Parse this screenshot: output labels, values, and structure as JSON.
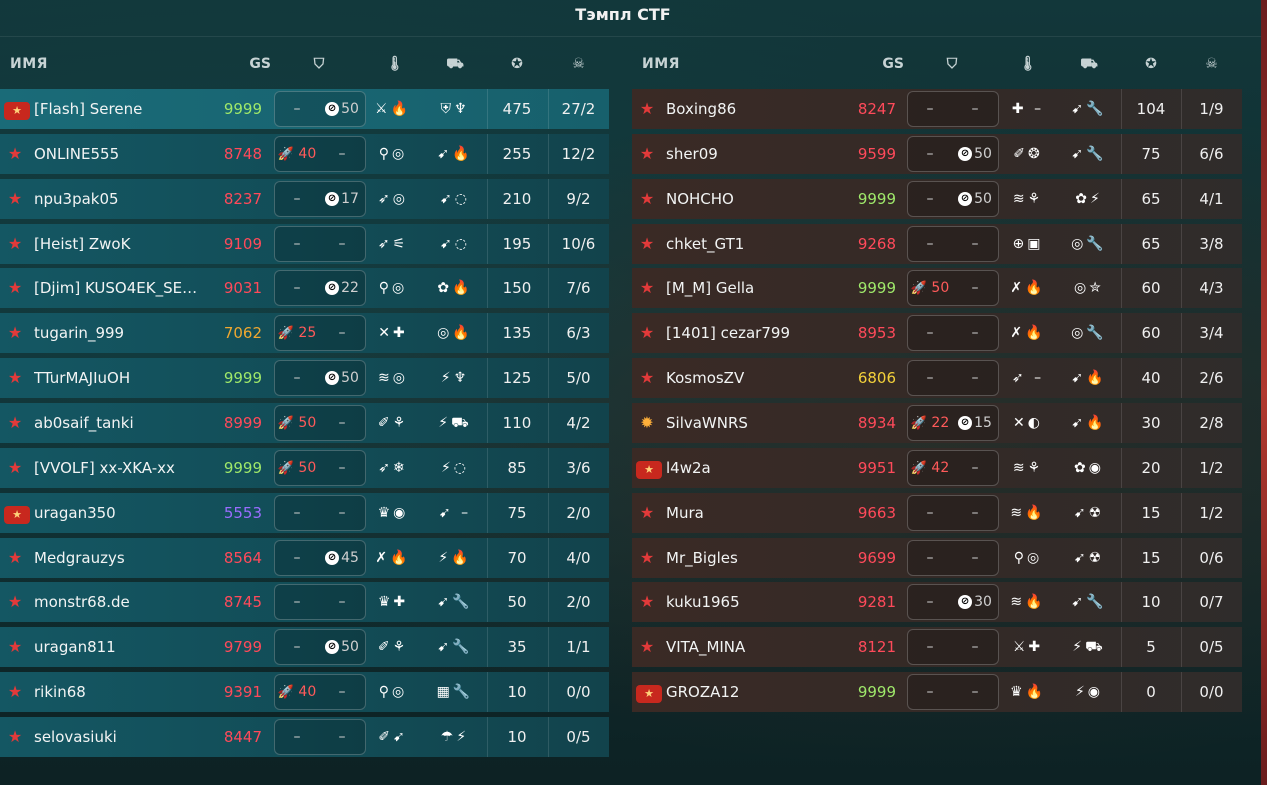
{
  "title": "Тэмпл CTF",
  "colors": {
    "gs_red": "#ff4a5a",
    "gs_green": "#9fe86a",
    "gs_orange": "#f0a830",
    "gs_purple": "#9a6cff",
    "gs_yellow": "#f3d13a"
  },
  "headers": {
    "name": "ИМЯ",
    "gs": "GS",
    "protect_icon": "shield-icon",
    "turret_icon": "thermometer-icon",
    "hull_icon": "tank-icon",
    "score_icon": "star-icon",
    "kd_icon": "skull-icon"
  },
  "team1": [
    {
      "name": "[Flash] Serene",
      "gs": "9999",
      "gs_color": "green",
      "sup_l": "–",
      "sup_r": "50",
      "sup_r_type": "cap",
      "eq1": "⚔🔥",
      "eq2": "⛨♆",
      "score": "475",
      "kd": "27/2",
      "rank": "legend"
    },
    {
      "name": "ONLINE555",
      "gs": "8748",
      "gs_color": "red",
      "sup_l": "40",
      "sup_l_type": "rocket",
      "sup_r": "–",
      "eq1": "⚲◎",
      "eq2": "➹🔥",
      "score": "255",
      "kd": "12/2",
      "rank": "star"
    },
    {
      "name": "npu3pak05",
      "gs": "8237",
      "gs_color": "red",
      "sup_l": "–",
      "sup_r": "17",
      "sup_r_type": "cap",
      "eq1": "➶◎",
      "eq2": "➹◌",
      "score": "210",
      "kd": "9/2",
      "rank": "star"
    },
    {
      "name": "[Heist] ZwoK",
      "gs": "9109",
      "gs_color": "red",
      "sup_l": "–",
      "sup_r": "–",
      "eq1": "➶⚟",
      "eq2": "➹◌",
      "score": "195",
      "kd": "10/6",
      "rank": "star"
    },
    {
      "name": "[Djim] KUSO4EK_SER...",
      "gs": "9031",
      "gs_color": "red",
      "sup_l": "–",
      "sup_r": "22",
      "sup_r_type": "cap",
      "eq1": "⚲◎",
      "eq2": "✿🔥",
      "score": "150",
      "kd": "7/6",
      "rank": "star"
    },
    {
      "name": "tugarin_999",
      "gs": "7062",
      "gs_color": "orange",
      "sup_l": "25",
      "sup_l_type": "rocket",
      "sup_r": "–",
      "eq1": "✕✚",
      "eq2": "◎🔥",
      "score": "135",
      "kd": "6/3",
      "rank": "star"
    },
    {
      "name": "TTurMAJIuOH",
      "gs": "9999",
      "gs_color": "green",
      "sup_l": "–",
      "sup_r": "50",
      "sup_r_type": "cap",
      "eq1": "≋◎",
      "eq2": "⚡♆",
      "score": "125",
      "kd": "5/0",
      "rank": "star"
    },
    {
      "name": "ab0saif_tanki",
      "gs": "8999",
      "gs_color": "red",
      "sup_l": "50",
      "sup_l_type": "rocket",
      "sup_r": "–",
      "eq1": "✐⚘",
      "eq2": "⚡⛟",
      "score": "110",
      "kd": "4/2",
      "rank": "star"
    },
    {
      "name": "[VVOLF] xx-XKA-xx",
      "gs": "9999",
      "gs_color": "green",
      "sup_l": "50",
      "sup_l_type": "rocket",
      "sup_r": "–",
      "eq1": "➶❄",
      "eq2": "⚡◌",
      "score": "85",
      "kd": "3/6",
      "rank": "star"
    },
    {
      "name": "uragan350",
      "gs": "5553",
      "gs_color": "purple",
      "sup_l": "–",
      "sup_r": "–",
      "eq1": "♛◉",
      "eq2": "➹ –",
      "score": "75",
      "kd": "2/0",
      "rank": "legend2"
    },
    {
      "name": "Medgrauzys",
      "gs": "8564",
      "gs_color": "red",
      "sup_l": "–",
      "sup_r": "45",
      "sup_r_type": "cap",
      "eq1": "✗🔥",
      "eq2": "⚡🔥",
      "score": "70",
      "kd": "4/0",
      "rank": "star"
    },
    {
      "name": "monstr68.de",
      "gs": "8745",
      "gs_color": "red",
      "sup_l": "–",
      "sup_r": "–",
      "eq1": "♛✚",
      "eq2": "➹🔧",
      "score": "50",
      "kd": "2/0",
      "rank": "star"
    },
    {
      "name": "uragan811",
      "gs": "9799",
      "gs_color": "red",
      "sup_l": "–",
      "sup_r": "50",
      "sup_r_type": "cap",
      "eq1": "✐⚘",
      "eq2": "➹🔧",
      "score": "35",
      "kd": "1/1",
      "rank": "star"
    },
    {
      "name": "rikin68",
      "gs": "9391",
      "gs_color": "red",
      "sup_l": "40",
      "sup_l_type": "rocket",
      "sup_r": "–",
      "eq1": "⚲◎",
      "eq2": "▦🔧",
      "score": "10",
      "kd": "0/0",
      "rank": "star"
    },
    {
      "name": "selovasiuki",
      "gs": "8447",
      "gs_color": "red",
      "sup_l": "–",
      "sup_r": "–",
      "eq1": "✐➹",
      "eq2": "☂⚡",
      "score": "10",
      "kd": "0/5",
      "rank": "star"
    }
  ],
  "team2": [
    {
      "name": "Boxing86",
      "gs": "8247",
      "gs_color": "red",
      "sup_l": "–",
      "sup_r": "–",
      "eq1": "✚ –",
      "eq2": "➹🔧",
      "score": "104",
      "kd": "1/9",
      "rank": "star"
    },
    {
      "name": "sher09",
      "gs": "9599",
      "gs_color": "red",
      "sup_l": "–",
      "sup_r": "50",
      "sup_r_type": "cap",
      "eq1": "✐❂",
      "eq2": "➹🔧",
      "score": "75",
      "kd": "6/6",
      "rank": "star"
    },
    {
      "name": "NOHCHO",
      "gs": "9999",
      "gs_color": "green",
      "sup_l": "–",
      "sup_r": "50",
      "sup_r_type": "cap",
      "eq1": "≋⚘",
      "eq2": "✿⚡",
      "score": "65",
      "kd": "4/1",
      "rank": "star"
    },
    {
      "name": "chket_GT1",
      "gs": "9268",
      "gs_color": "red",
      "sup_l": "–",
      "sup_r": "–",
      "eq1": "⊕▣",
      "eq2": "◎🔧",
      "score": "65",
      "kd": "3/8",
      "rank": "star"
    },
    {
      "name": "[M_M] Gella",
      "gs": "9999",
      "gs_color": "green",
      "sup_l": "50",
      "sup_l_type": "rocket",
      "sup_r": "–",
      "eq1": "✗🔥",
      "eq2": "◎✮",
      "score": "60",
      "kd": "4/3",
      "rank": "star"
    },
    {
      "name": "[1401] cezar799",
      "gs": "8953",
      "gs_color": "red",
      "sup_l": "–",
      "sup_r": "–",
      "eq1": "✗🔥",
      "eq2": "◎🔧",
      "score": "60",
      "kd": "3/4",
      "rank": "star"
    },
    {
      "name": "KosmosZV",
      "gs": "6806",
      "gs_color": "yellow",
      "sup_l": "–",
      "sup_r": "–",
      "eq1": "➶ –",
      "eq2": "➹🔥",
      "score": "40",
      "kd": "2/6",
      "rank": "star"
    },
    {
      "name": "SilvaWNRS",
      "gs": "8934",
      "gs_color": "red",
      "sup_l": "22",
      "sup_l_type": "rocket",
      "sup_r": "15",
      "sup_r_type": "cap",
      "eq1": "✕◐",
      "eq2": "➹🔥",
      "score": "30",
      "kd": "2/8",
      "rank": "gold"
    },
    {
      "name": "l4w2a",
      "gs": "9951",
      "gs_color": "red",
      "sup_l": "42",
      "sup_l_type": "rocket",
      "sup_r": "–",
      "eq1": "≋⚘",
      "eq2": "✿◉",
      "score": "20",
      "kd": "1/2",
      "rank": "legend"
    },
    {
      "name": "Mura",
      "gs": "9663",
      "gs_color": "red",
      "sup_l": "–",
      "sup_r": "–",
      "eq1": "≋🔥",
      "eq2": "➹☢",
      "score": "15",
      "kd": "1/2",
      "rank": "star"
    },
    {
      "name": "Mr_Bigles",
      "gs": "9699",
      "gs_color": "red",
      "sup_l": "–",
      "sup_r": "–",
      "eq1": "⚲◎",
      "eq2": "➹☢",
      "score": "15",
      "kd": "0/6",
      "rank": "star"
    },
    {
      "name": "kuku1965",
      "gs": "9281",
      "gs_color": "red",
      "sup_l": "–",
      "sup_r": "30",
      "sup_r_type": "cap",
      "eq1": "≋🔥",
      "eq2": "➹🔧",
      "score": "10",
      "kd": "0/7",
      "rank": "star"
    },
    {
      "name": "VITA_MINA",
      "gs": "8121",
      "gs_color": "red",
      "sup_l": "–",
      "sup_r": "–",
      "eq1": "⚔✚",
      "eq2": "⚡⛟",
      "score": "5",
      "kd": "0/5",
      "rank": "star"
    },
    {
      "name": "GROZA12",
      "gs": "9999",
      "gs_color": "green",
      "sup_l": "–",
      "sup_r": "–",
      "eq1": "♛🔥",
      "eq2": "⚡◉",
      "score": "0",
      "kd": "0/0",
      "rank": "legend"
    }
  ]
}
